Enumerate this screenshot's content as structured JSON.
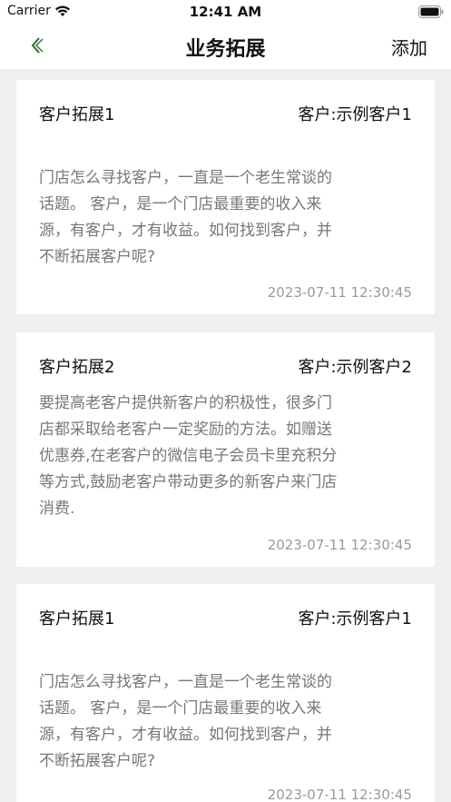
{
  "status_bar": {
    "carrier": "Carrier",
    "time": "12:41 AM"
  },
  "nav": {
    "title": "业务拓展",
    "add_label": "添加",
    "back_icon": "chevron-left-icon",
    "accent_color": "#2e6b2e"
  },
  "cards": [
    {
      "title": "客户拓展1",
      "customer": "客户:示例客户1",
      "body_lines": [
        "门店怎么寻找客户，一直是一个老生常谈的",
        "话题。 客户，是一个门店最重要的收入来",
        "源，有客户，才有收益。如何找到客户，并",
        "不断拓展客户呢?"
      ],
      "time": "2023-07-11 12:30:45"
    },
    {
      "title": "客户拓展2",
      "customer": "客户:示例客户2",
      "body_lines": [
        "要提高老客户提供新客户的积极性，很多门",
        "店都采取给老客户一定奖励的方法。如赠送",
        "优惠券,在老客户的微信电子会员卡里充积分",
        "等方式,鼓励老客户带动更多的新客户来门店",
        "消费."
      ],
      "time": "2023-07-11 12:30:45"
    },
    {
      "title": "客户拓展1",
      "customer": "客户:示例客户1",
      "body_lines": [
        "门店怎么寻找客户，一直是一个老生常谈的",
        "话题。 客户，是一个门店最重要的收入来",
        "源，有客户，才有收益。如何找到客户，并",
        "不断拓展客户呢?"
      ],
      "time": "2023-07-11 12:30:45"
    }
  ]
}
